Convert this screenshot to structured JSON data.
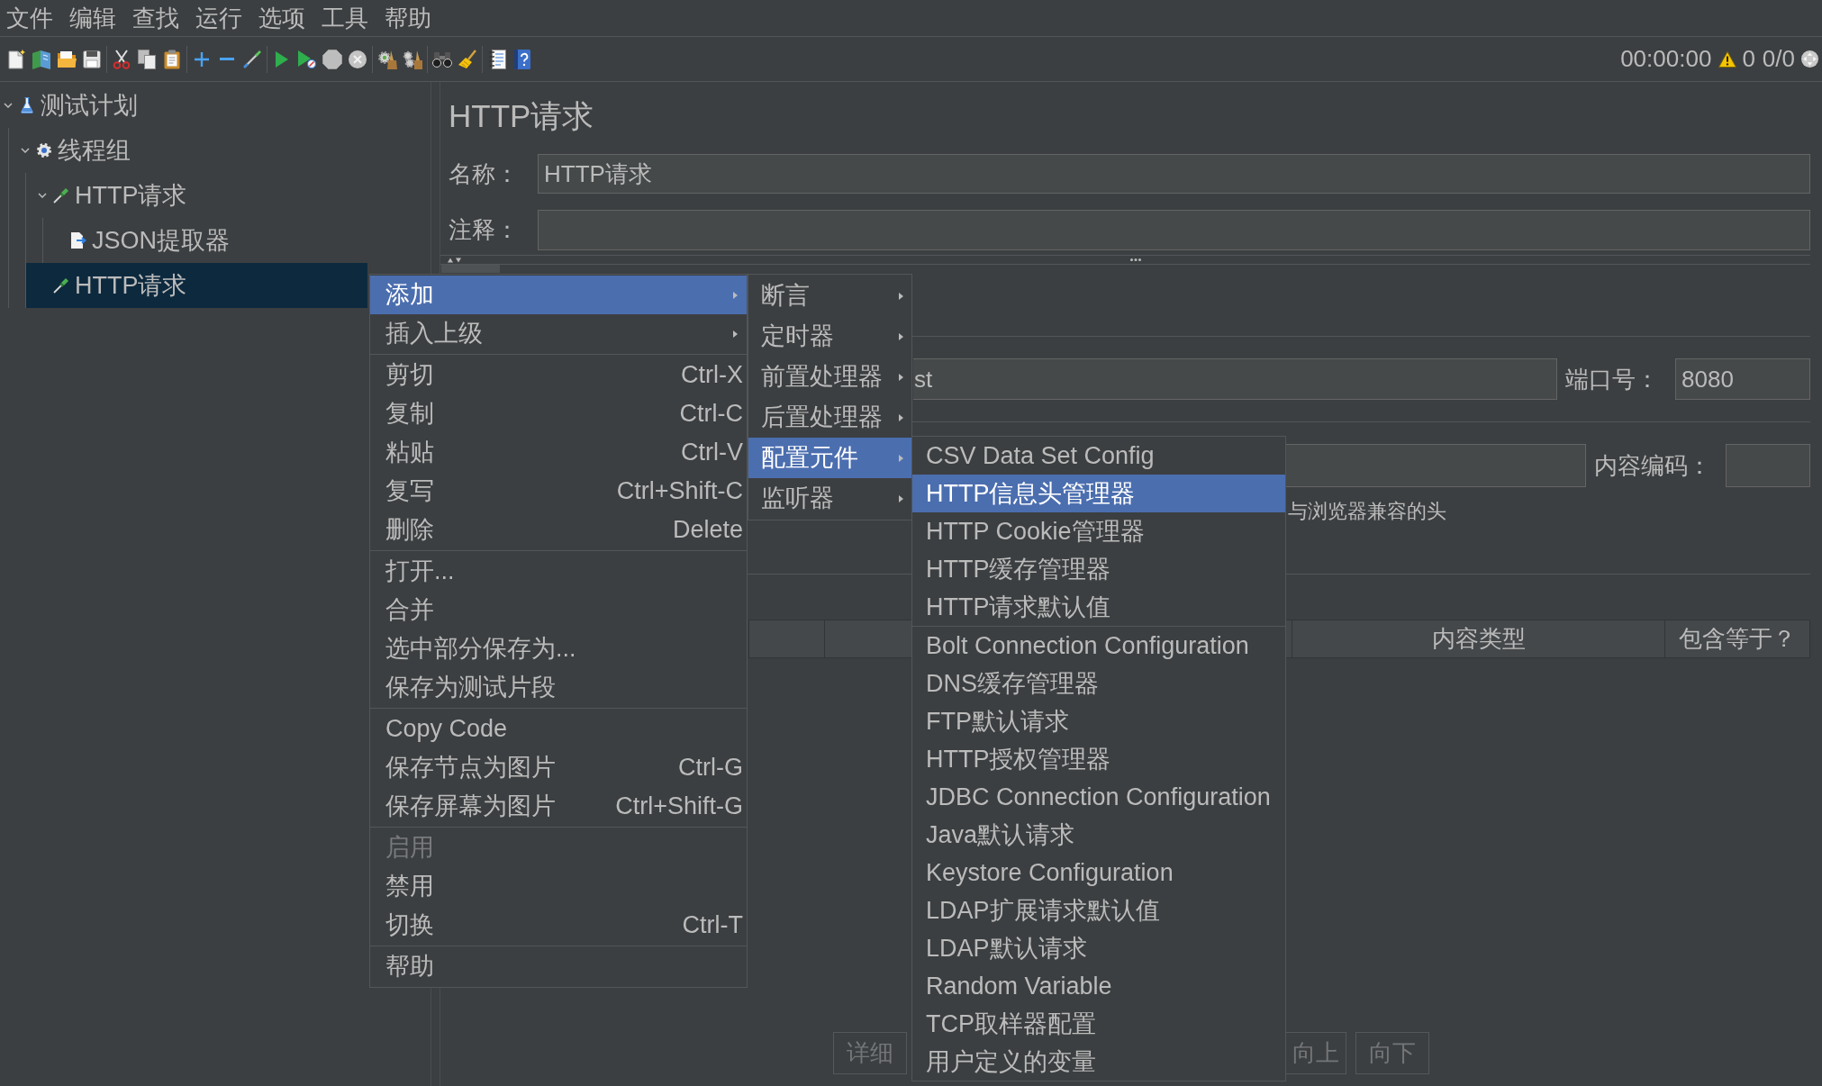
{
  "menu_bar": [
    "文件",
    "编辑",
    "查找",
    "运行",
    "选项",
    "工具",
    "帮助"
  ],
  "toolbar": {
    "elapsed": "00:00:00",
    "errors": "0",
    "threads": "0/0"
  },
  "tree": [
    {
      "label": "测试计划",
      "kind": "plan",
      "expanded": true,
      "selected": false,
      "children": [
        {
          "label": "线程组",
          "kind": "group",
          "expanded": true,
          "selected": false,
          "children": [
            {
              "label": "HTTP请求",
              "kind": "sampler",
              "expanded": true,
              "selected": false,
              "children": [
                {
                  "label": "JSON提取器",
                  "kind": "extractor",
                  "selected": false
                }
              ]
            },
            {
              "label": "HTTP请求",
              "kind": "sampler",
              "selected": true
            }
          ]
        }
      ]
    }
  ],
  "editor": {
    "title": "HTTP请求",
    "name": {
      "label": "名称：",
      "value": "HTTP请求"
    },
    "comment": {
      "label": "注释："
    },
    "server": {
      "value": "st"
    },
    "port": {
      "label": "端口号：",
      "value": "8080"
    },
    "encoding": {
      "label": "内容编码："
    },
    "browser_headers": {
      "label": "与浏览器兼容的头"
    },
    "table": {
      "columns": [
        "内容类型",
        "包含等于？"
      ]
    },
    "buttons": [
      {
        "label": "详细",
        "disabled": true
      },
      {
        "label": "向上",
        "disabled": true
      },
      {
        "label": "向下",
        "disabled": true
      }
    ]
  },
  "context_menu": {
    "groups": [
      [
        {
          "label": "添加",
          "submenu": true,
          "selected": true,
          "disabled": false
        },
        {
          "label": "插入上级",
          "submenu": true,
          "selected": false,
          "disabled": false
        }
      ],
      [
        {
          "label": "剪切",
          "shortcut": "Ctrl-X",
          "submenu": false,
          "selected": false,
          "disabled": false
        },
        {
          "label": "复制",
          "shortcut": "Ctrl-C",
          "submenu": false,
          "selected": false,
          "disabled": false
        },
        {
          "label": "粘贴",
          "shortcut": "Ctrl-V",
          "submenu": false,
          "selected": false,
          "disabled": false
        },
        {
          "label": "复写",
          "shortcut": "Ctrl+Shift-C",
          "submenu": false,
          "selected": false,
          "disabled": false
        },
        {
          "label": "删除",
          "shortcut": "Delete",
          "submenu": false,
          "selected": false,
          "disabled": false
        }
      ],
      [
        {
          "label": "打开...",
          "submenu": false,
          "selected": false,
          "disabled": false
        },
        {
          "label": "合并",
          "submenu": false,
          "selected": false,
          "disabled": false
        },
        {
          "label": "选中部分保存为...",
          "submenu": false,
          "selected": false,
          "disabled": false
        },
        {
          "label": "保存为测试片段",
          "submenu": false,
          "selected": false,
          "disabled": false
        }
      ],
      [
        {
          "label": "Copy Code",
          "submenu": false,
          "selected": false,
          "disabled": false
        },
        {
          "label": "保存节点为图片",
          "shortcut": "Ctrl-G",
          "submenu": false,
          "selected": false,
          "disabled": false
        },
        {
          "label": "保存屏幕为图片",
          "shortcut": "Ctrl+Shift-G",
          "submenu": false,
          "selected": false,
          "disabled": false
        }
      ],
      [
        {
          "label": "启用",
          "submenu": false,
          "selected": false,
          "disabled": true
        },
        {
          "label": "禁用",
          "submenu": false,
          "selected": false,
          "disabled": false
        },
        {
          "label": "切换",
          "shortcut": "Ctrl-T",
          "submenu": false,
          "selected": false,
          "disabled": false
        }
      ],
      [
        {
          "label": "帮助",
          "submenu": false,
          "selected": false,
          "disabled": false
        }
      ]
    ]
  },
  "add_submenu": {
    "items": [
      {
        "label": "断言",
        "submenu": true,
        "selected": false
      },
      {
        "label": "定时器",
        "submenu": true,
        "selected": false
      },
      {
        "label": "前置处理器",
        "submenu": true,
        "selected": false
      },
      {
        "label": "后置处理器",
        "submenu": true,
        "selected": false
      },
      {
        "label": "配置元件",
        "submenu": true,
        "selected": true
      },
      {
        "label": "监听器",
        "submenu": true,
        "selected": false
      }
    ]
  },
  "config_submenu": {
    "groups": [
      [
        {
          "label": "CSV Data Set Config",
          "selected": false
        },
        {
          "label": "HTTP信息头管理器",
          "selected": true
        },
        {
          "label": "HTTP Cookie管理器",
          "selected": false
        },
        {
          "label": "HTTP缓存管理器",
          "selected": false
        },
        {
          "label": "HTTP请求默认值",
          "selected": false
        }
      ],
      [
        {
          "label": "Bolt Connection Configuration",
          "selected": false
        },
        {
          "label": "DNS缓存管理器",
          "selected": false
        },
        {
          "label": "FTP默认请求",
          "selected": false
        },
        {
          "label": "HTTP授权管理器",
          "selected": false
        },
        {
          "label": "JDBC Connection Configuration",
          "selected": false
        },
        {
          "label": "Java默认请求",
          "selected": false
        },
        {
          "label": "Keystore Configuration",
          "selected": false
        },
        {
          "label": "LDAP扩展请求默认值",
          "selected": false
        },
        {
          "label": "LDAP默认请求",
          "selected": false
        },
        {
          "label": "Random Variable",
          "selected": false
        },
        {
          "label": "TCP取样器配置",
          "selected": false
        },
        {
          "label": "用户定义的变量",
          "selected": false
        }
      ]
    ]
  }
}
